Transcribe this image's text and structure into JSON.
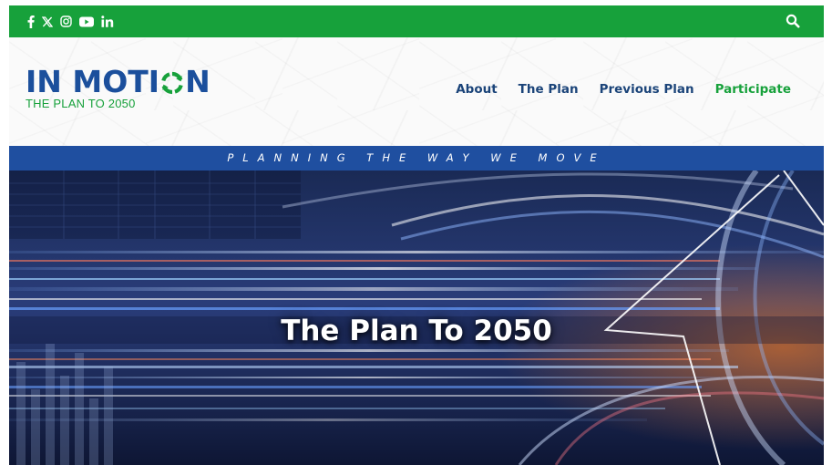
{
  "topbar": {
    "social_icons": [
      "facebook-icon",
      "x-icon",
      "instagram-icon",
      "youtube-icon",
      "linkedin-icon"
    ],
    "search_icon": "search-icon",
    "color": "#17a13b"
  },
  "header": {
    "logo": {
      "main": "IN MOTION",
      "sub": "THE PLAN TO 2050",
      "main_color": "#1b4f9c",
      "accent_color": "#17a13b"
    },
    "nav": {
      "about": "About",
      "the_plan": "The Plan",
      "previous_plan": "Previous Plan",
      "participate": "Participate"
    },
    "nav_color": "#1b4479",
    "nav_active_color": "#17a13b"
  },
  "tagline": {
    "text": "PLANNING THE WAY WE MOVE",
    "color": "#1f4fa0"
  },
  "hero": {
    "title": "The Plan To 2050"
  }
}
